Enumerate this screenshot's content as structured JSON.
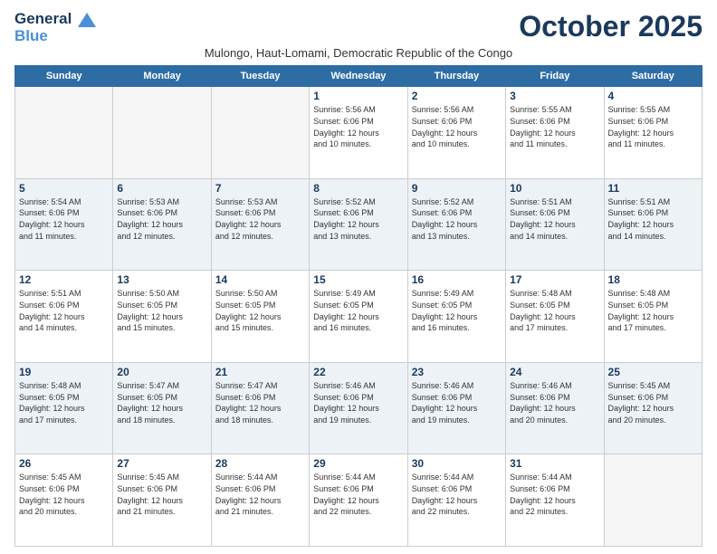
{
  "logo": {
    "line1": "General",
    "line2": "Blue"
  },
  "title": "October 2025",
  "subtitle": "Mulongo, Haut-Lomami, Democratic Republic of the Congo",
  "days_of_week": [
    "Sunday",
    "Monday",
    "Tuesday",
    "Wednesday",
    "Thursday",
    "Friday",
    "Saturday"
  ],
  "weeks": [
    [
      {
        "day": "",
        "info": ""
      },
      {
        "day": "",
        "info": ""
      },
      {
        "day": "",
        "info": ""
      },
      {
        "day": "1",
        "info": "Sunrise: 5:56 AM\nSunset: 6:06 PM\nDaylight: 12 hours\nand 10 minutes."
      },
      {
        "day": "2",
        "info": "Sunrise: 5:56 AM\nSunset: 6:06 PM\nDaylight: 12 hours\nand 10 minutes."
      },
      {
        "day": "3",
        "info": "Sunrise: 5:55 AM\nSunset: 6:06 PM\nDaylight: 12 hours\nand 11 minutes."
      },
      {
        "day": "4",
        "info": "Sunrise: 5:55 AM\nSunset: 6:06 PM\nDaylight: 12 hours\nand 11 minutes."
      }
    ],
    [
      {
        "day": "5",
        "info": "Sunrise: 5:54 AM\nSunset: 6:06 PM\nDaylight: 12 hours\nand 11 minutes."
      },
      {
        "day": "6",
        "info": "Sunrise: 5:53 AM\nSunset: 6:06 PM\nDaylight: 12 hours\nand 12 minutes."
      },
      {
        "day": "7",
        "info": "Sunrise: 5:53 AM\nSunset: 6:06 PM\nDaylight: 12 hours\nand 12 minutes."
      },
      {
        "day": "8",
        "info": "Sunrise: 5:52 AM\nSunset: 6:06 PM\nDaylight: 12 hours\nand 13 minutes."
      },
      {
        "day": "9",
        "info": "Sunrise: 5:52 AM\nSunset: 6:06 PM\nDaylight: 12 hours\nand 13 minutes."
      },
      {
        "day": "10",
        "info": "Sunrise: 5:51 AM\nSunset: 6:06 PM\nDaylight: 12 hours\nand 14 minutes."
      },
      {
        "day": "11",
        "info": "Sunrise: 5:51 AM\nSunset: 6:06 PM\nDaylight: 12 hours\nand 14 minutes."
      }
    ],
    [
      {
        "day": "12",
        "info": "Sunrise: 5:51 AM\nSunset: 6:06 PM\nDaylight: 12 hours\nand 14 minutes."
      },
      {
        "day": "13",
        "info": "Sunrise: 5:50 AM\nSunset: 6:05 PM\nDaylight: 12 hours\nand 15 minutes."
      },
      {
        "day": "14",
        "info": "Sunrise: 5:50 AM\nSunset: 6:05 PM\nDaylight: 12 hours\nand 15 minutes."
      },
      {
        "day": "15",
        "info": "Sunrise: 5:49 AM\nSunset: 6:05 PM\nDaylight: 12 hours\nand 16 minutes."
      },
      {
        "day": "16",
        "info": "Sunrise: 5:49 AM\nSunset: 6:05 PM\nDaylight: 12 hours\nand 16 minutes."
      },
      {
        "day": "17",
        "info": "Sunrise: 5:48 AM\nSunset: 6:05 PM\nDaylight: 12 hours\nand 17 minutes."
      },
      {
        "day": "18",
        "info": "Sunrise: 5:48 AM\nSunset: 6:05 PM\nDaylight: 12 hours\nand 17 minutes."
      }
    ],
    [
      {
        "day": "19",
        "info": "Sunrise: 5:48 AM\nSunset: 6:05 PM\nDaylight: 12 hours\nand 17 minutes."
      },
      {
        "day": "20",
        "info": "Sunrise: 5:47 AM\nSunset: 6:05 PM\nDaylight: 12 hours\nand 18 minutes."
      },
      {
        "day": "21",
        "info": "Sunrise: 5:47 AM\nSunset: 6:06 PM\nDaylight: 12 hours\nand 18 minutes."
      },
      {
        "day": "22",
        "info": "Sunrise: 5:46 AM\nSunset: 6:06 PM\nDaylight: 12 hours\nand 19 minutes."
      },
      {
        "day": "23",
        "info": "Sunrise: 5:46 AM\nSunset: 6:06 PM\nDaylight: 12 hours\nand 19 minutes."
      },
      {
        "day": "24",
        "info": "Sunrise: 5:46 AM\nSunset: 6:06 PM\nDaylight: 12 hours\nand 20 minutes."
      },
      {
        "day": "25",
        "info": "Sunrise: 5:45 AM\nSunset: 6:06 PM\nDaylight: 12 hours\nand 20 minutes."
      }
    ],
    [
      {
        "day": "26",
        "info": "Sunrise: 5:45 AM\nSunset: 6:06 PM\nDaylight: 12 hours\nand 20 minutes."
      },
      {
        "day": "27",
        "info": "Sunrise: 5:45 AM\nSunset: 6:06 PM\nDaylight: 12 hours\nand 21 minutes."
      },
      {
        "day": "28",
        "info": "Sunrise: 5:44 AM\nSunset: 6:06 PM\nDaylight: 12 hours\nand 21 minutes."
      },
      {
        "day": "29",
        "info": "Sunrise: 5:44 AM\nSunset: 6:06 PM\nDaylight: 12 hours\nand 22 minutes."
      },
      {
        "day": "30",
        "info": "Sunrise: 5:44 AM\nSunset: 6:06 PM\nDaylight: 12 hours\nand 22 minutes."
      },
      {
        "day": "31",
        "info": "Sunrise: 5:44 AM\nSunset: 6:06 PM\nDaylight: 12 hours\nand 22 minutes."
      },
      {
        "day": "",
        "info": ""
      }
    ]
  ]
}
